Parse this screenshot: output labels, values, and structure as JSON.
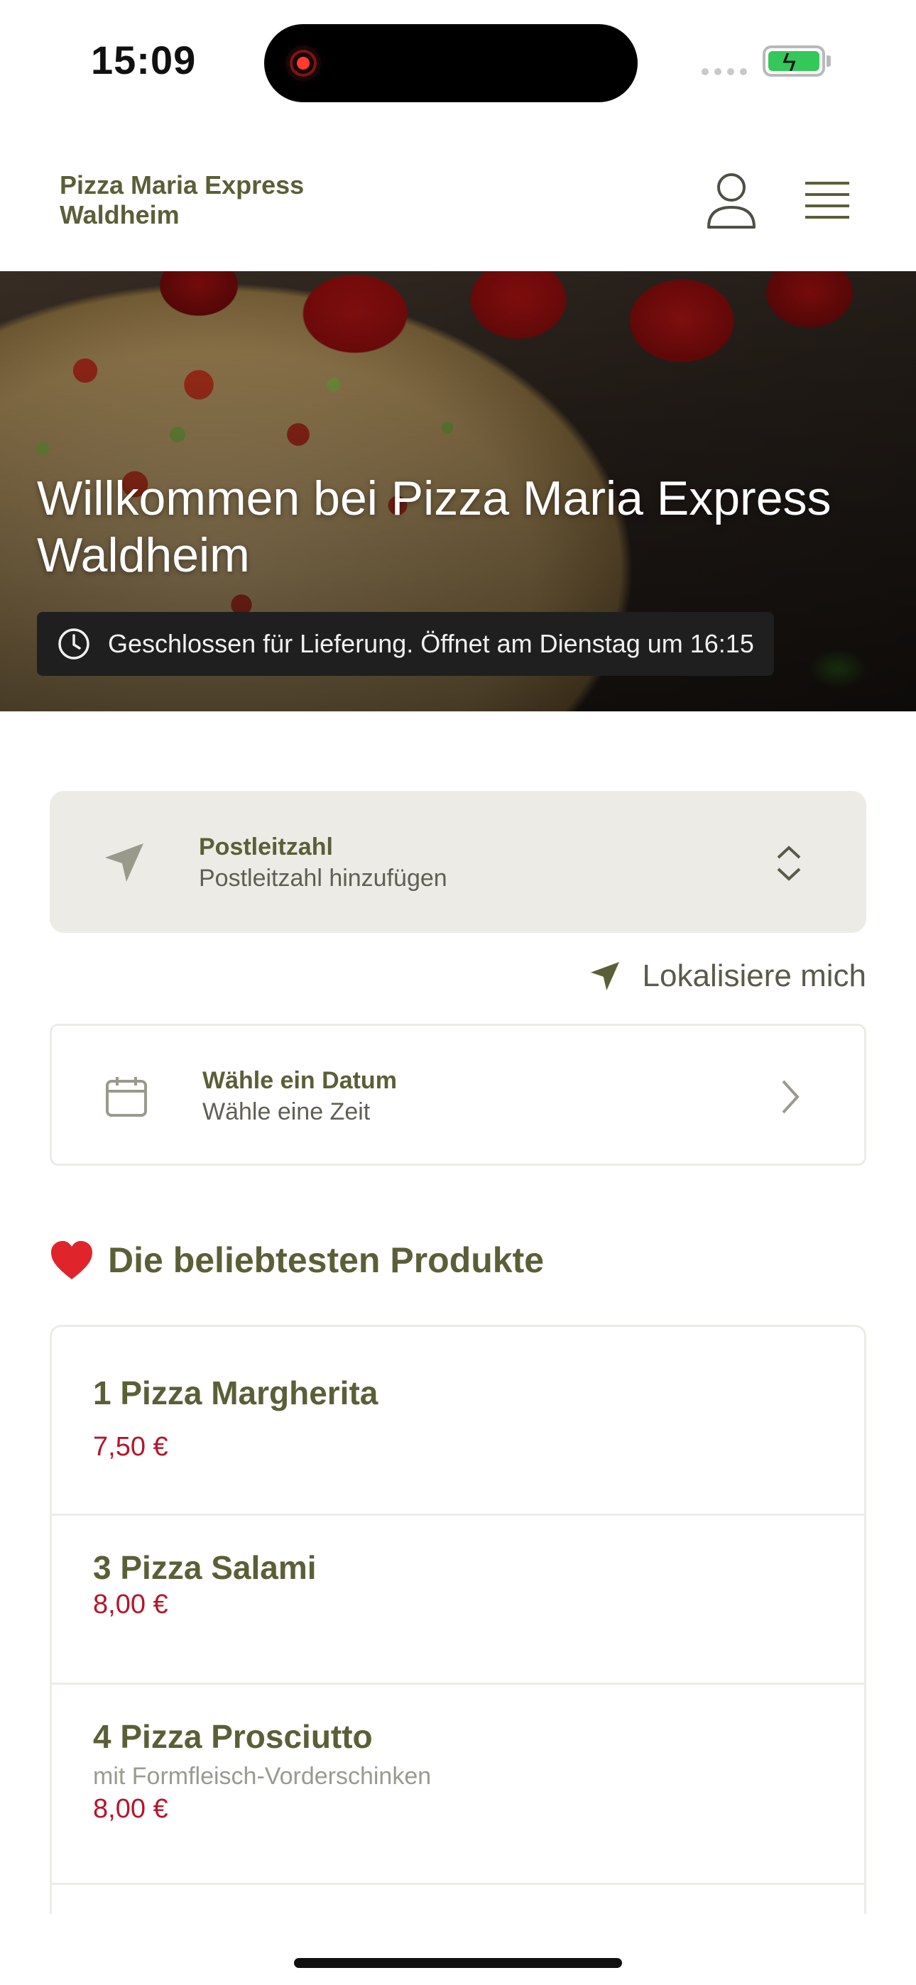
{
  "status_bar": {
    "time": "15:09"
  },
  "header": {
    "brand": "Pizza Maria Express Waldheim"
  },
  "hero": {
    "title": "Willkommen bei Pizza Maria Express Waldheim",
    "status": "Geschlossen für Lieferung. Öffnet am Dienstag um 16:15"
  },
  "zip": {
    "label": "Postleitzahl",
    "placeholder": "Postleitzahl hinzufügen"
  },
  "locate": {
    "label": "Lokalisiere mich"
  },
  "date": {
    "label": "Wähle ein Datum",
    "sub": "Wähle eine Zeit"
  },
  "popular": {
    "title": "Die beliebtesten Produkte",
    "products": [
      {
        "name": "1 Pizza Margherita",
        "price": "7,50 €"
      },
      {
        "name": "3 Pizza Salami",
        "price": "8,00 €"
      },
      {
        "name": "4 Pizza Prosciutto",
        "description": "mit Formfleisch-Vorderschinken",
        "price": "8,00 €"
      }
    ]
  },
  "colors": {
    "accent": "#5b5f37",
    "price": "#b3162b",
    "card_bg": "#edebe6"
  }
}
